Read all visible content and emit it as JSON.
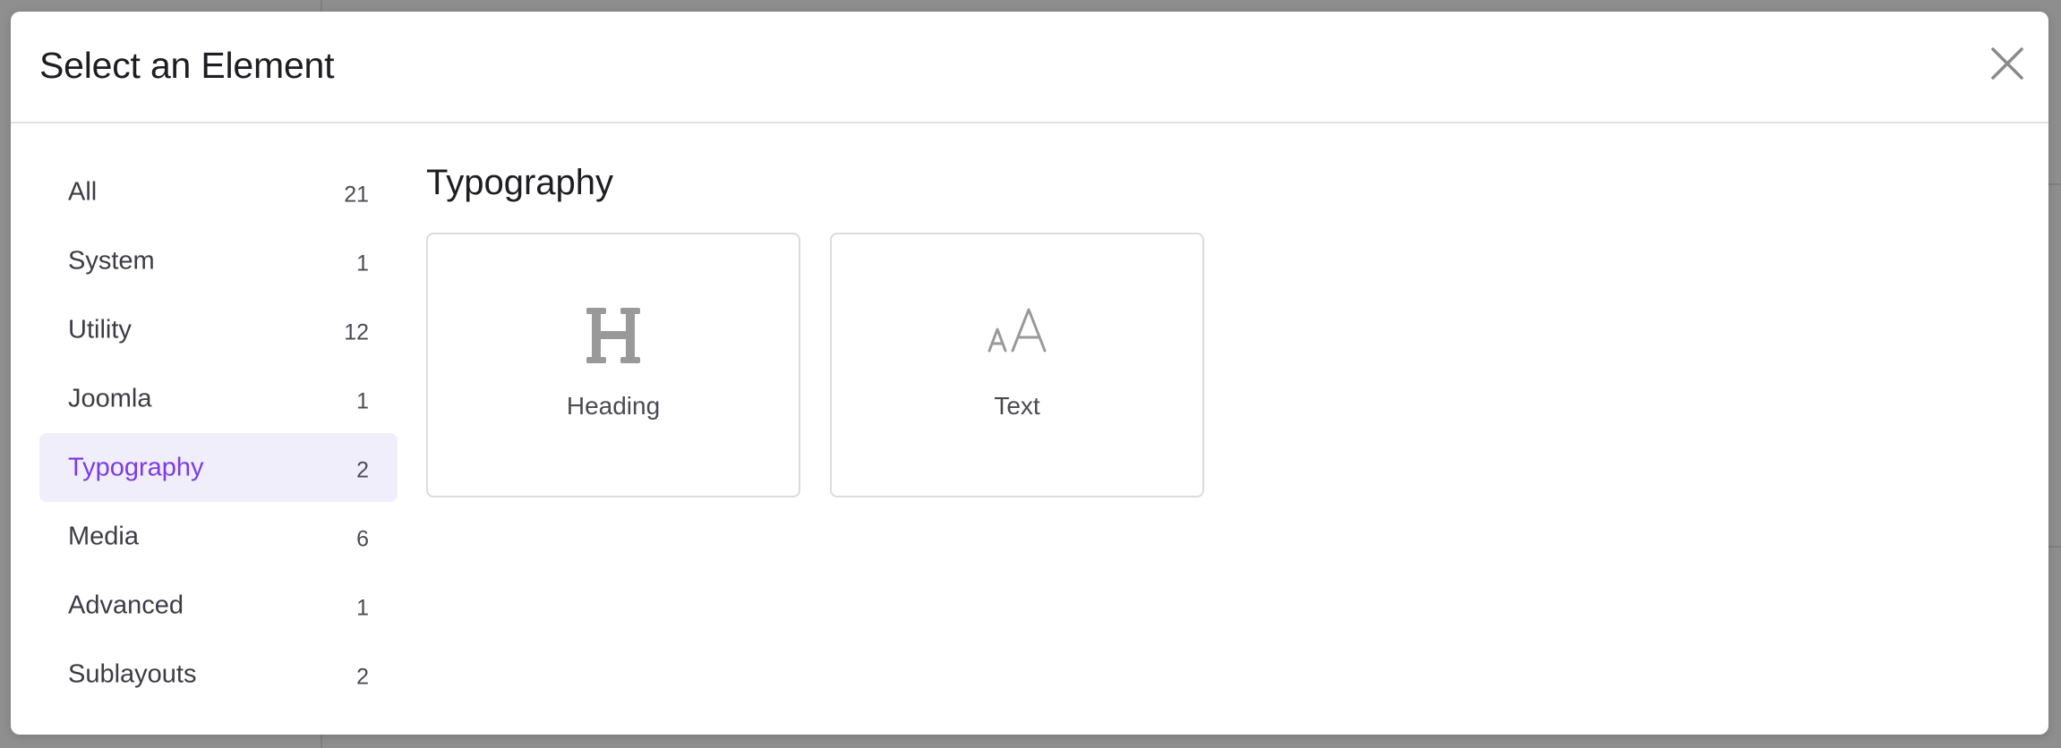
{
  "modal": {
    "title": "Select an Element"
  },
  "categories": [
    {
      "label": "All",
      "count": "21"
    },
    {
      "label": "System",
      "count": "1"
    },
    {
      "label": "Utility",
      "count": "12"
    },
    {
      "label": "Joomla",
      "count": "1"
    },
    {
      "label": "Typography",
      "count": "2",
      "active": true
    },
    {
      "label": "Media",
      "count": "6"
    },
    {
      "label": "Advanced",
      "count": "1"
    },
    {
      "label": "Sublayouts",
      "count": "2"
    }
  ],
  "section": {
    "title": "Typography"
  },
  "elements": [
    {
      "label": "Heading",
      "icon": "heading-icon"
    },
    {
      "label": "Text",
      "icon": "text-size-icon"
    }
  ],
  "colors": {
    "accent": "#7b3ce6",
    "active_background": "#f1eefb",
    "icon": "#999999"
  }
}
